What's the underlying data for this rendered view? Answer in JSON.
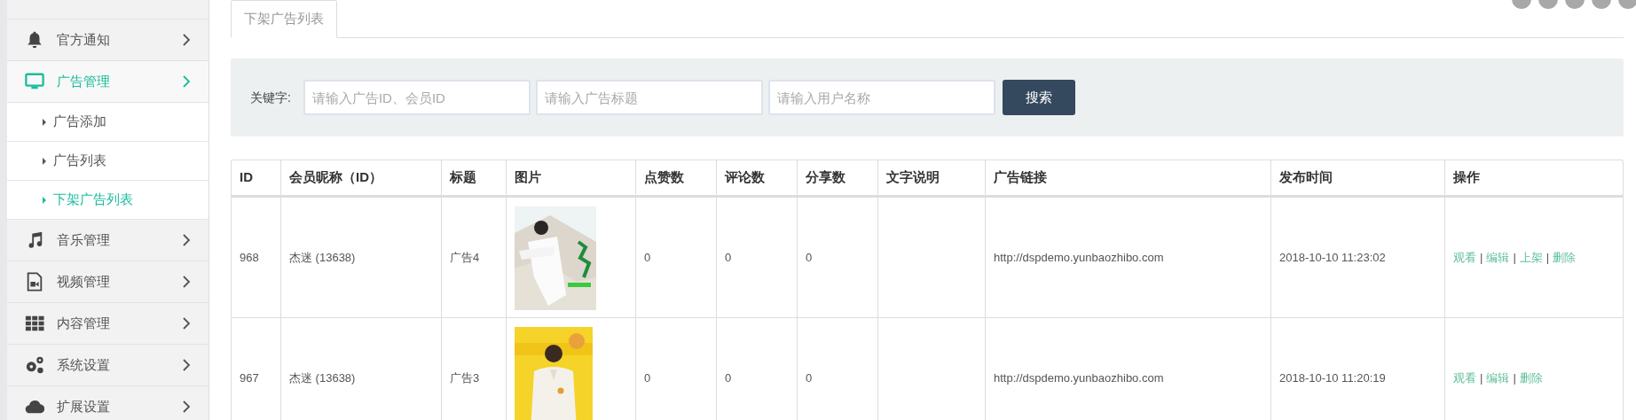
{
  "sidebar": {
    "items": [
      {
        "label": "官方通知",
        "selected": false
      },
      {
        "label": "广告管理",
        "selected": true,
        "children": [
          {
            "label": "广告添加",
            "selected": false
          },
          {
            "label": "广告列表",
            "selected": false
          },
          {
            "label": "下架广告列表",
            "selected": true
          }
        ]
      },
      {
        "label": "音乐管理",
        "selected": false
      },
      {
        "label": "视频管理",
        "selected": false
      },
      {
        "label": "内容管理",
        "selected": false
      },
      {
        "label": "系统设置",
        "selected": false
      },
      {
        "label": "扩展设置",
        "selected": false
      }
    ]
  },
  "tabs": [
    {
      "label": "下架广告列表",
      "selected": true
    }
  ],
  "search": {
    "label": "关键字:",
    "fields": [
      {
        "placeholder": "请输入广告ID、会员ID"
      },
      {
        "placeholder": "请输入广告标题"
      },
      {
        "placeholder": "请输入用户名称"
      }
    ],
    "button": "搜索"
  },
  "table": {
    "columns": [
      "ID",
      "会员昵称（ID）",
      "标题",
      "图片",
      "点赞数",
      "评论数",
      "分享数",
      "文字说明",
      "广告链接",
      "发布时间",
      "操作"
    ],
    "separator": "|",
    "rows": [
      {
        "id": "968",
        "member": "杰迷 (13638)",
        "title": "广告4",
        "image": {
          "kind": "picture"
        },
        "likes": "0",
        "comments": "0",
        "shares": "0",
        "link": "http://dspdemo.yunbaozhibo.com",
        "time": "2018-10-10 11:23:02",
        "actions": [
          "观看",
          "编辑",
          "上架",
          "删除"
        ]
      },
      {
        "id": "967",
        "member": "杰迷 (13638)",
        "title": "广告3",
        "image": {
          "kind": "picture"
        },
        "likes": "0",
        "comments": "0",
        "shares": "0",
        "link": "http://dspdemo.yunbaozhibo.com",
        "time": "2018-10-10 11:20:19",
        "actions": [
          "观看",
          "编辑",
          "删除"
        ]
      }
    ]
  }
}
